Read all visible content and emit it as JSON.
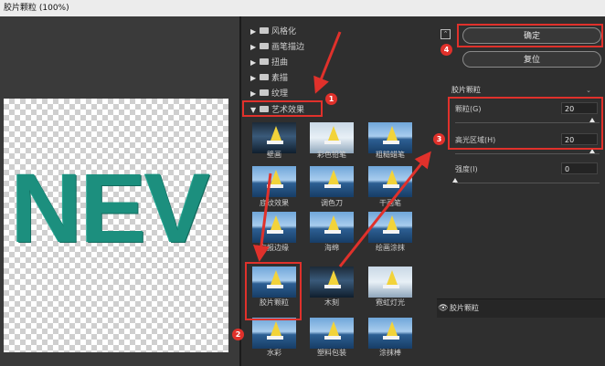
{
  "window": {
    "title": "胶片颗粒 (100%)"
  },
  "filter_gallery": {
    "categories": [
      {
        "label": "风格化",
        "expanded": false
      },
      {
        "label": "画笔描边",
        "expanded": false
      },
      {
        "label": "扭曲",
        "expanded": false
      },
      {
        "label": "素描",
        "expanded": false
      },
      {
        "label": "纹理",
        "expanded": false
      },
      {
        "label": "艺术效果",
        "expanded": true
      }
    ],
    "thumbnails": [
      {
        "label": "壁画"
      },
      {
        "label": "彩色铅笔"
      },
      {
        "label": "粗糙蜡笔"
      },
      {
        "label": "底纹效果"
      },
      {
        "label": "调色刀"
      },
      {
        "label": "干画笔"
      },
      {
        "label": "海报边缘"
      },
      {
        "label": "海绵"
      },
      {
        "label": "绘画涂抹"
      },
      {
        "label": "胶片颗粒",
        "selected": true
      },
      {
        "label": "木刻"
      },
      {
        "label": "霓虹灯光"
      },
      {
        "label": "水彩"
      },
      {
        "label": "塑料包装"
      },
      {
        "label": "涂抹棒"
      }
    ]
  },
  "preview": {
    "text": "NEV"
  },
  "buttons": {
    "ok": "确定",
    "reset": "复位"
  },
  "settings": {
    "filter_select": "胶片颗粒",
    "params": [
      {
        "label": "颗粒(G)",
        "value": "20",
        "level": 0.95
      },
      {
        "label": "高光区域(H)",
        "value": "20",
        "level": 0.95
      },
      {
        "label": "强度(I)",
        "value": "0",
        "level": 0.0
      }
    ]
  },
  "layer": {
    "label": "胶片颗粒"
  },
  "annotations": {
    "badges": [
      "1",
      "2",
      "3",
      "4"
    ]
  },
  "colors": {
    "annotation_red": "#e0312b",
    "text_teal": "#1c8f7e"
  }
}
